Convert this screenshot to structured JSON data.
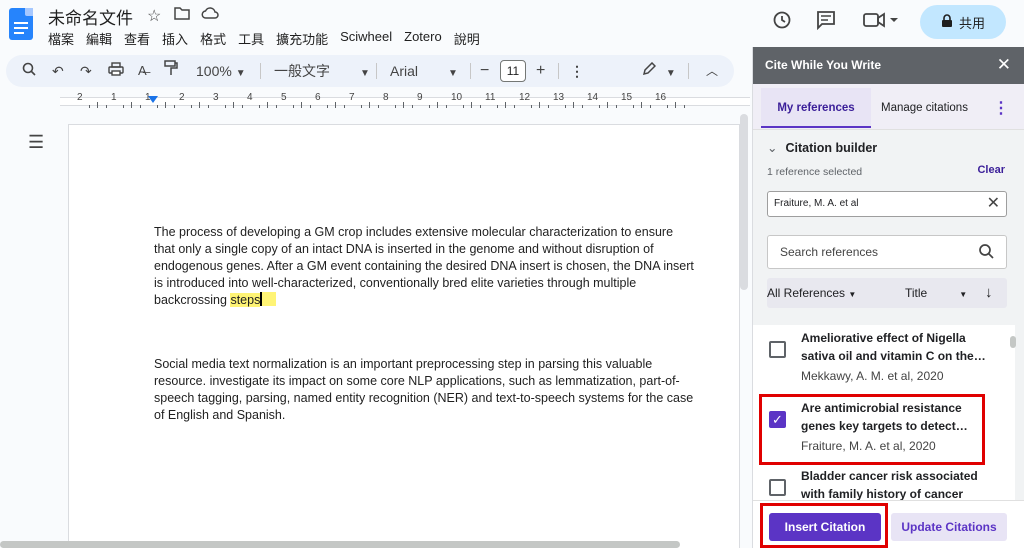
{
  "header": {
    "doc_title": "未命名文件",
    "menus": [
      "檔案",
      "編輯",
      "查看",
      "插入",
      "格式",
      "工具",
      "擴充功能",
      "Sciwheel",
      "Zotero",
      "說明"
    ],
    "share_label": "共用"
  },
  "toolbar": {
    "zoom": "100%",
    "style": "一般文字",
    "font": "Arial",
    "font_size": "11",
    "minus": "−",
    "plus": "+"
  },
  "ruler": {
    "numbers": [
      "2",
      "1",
      "1",
      "2",
      "3",
      "4",
      "5",
      "6",
      "7",
      "8",
      "9",
      "10",
      "11",
      "12",
      "13",
      "14",
      "15",
      "16"
    ]
  },
  "document": {
    "para1_main": "The process of developing a GM crop includes extensive molecular characterization to ensure that only a single copy of an intact DNA is inserted in the genome and without disruption of endogenous genes. After a GM event containing the desired DNA insert is chosen, the DNA insert is introduced into well-characterized, conventionally bred elite varieties through multiple backcrossing ",
    "para1_highlight": "steps",
    "para2": "Social media text normalization is an important preprocessing step in parsing this valuable resource. investigate its impact on some core NLP applications, such as lemmatization, part-of-speech tagging, parsing, named entity recognition (NER) and text-to-speech systems for the case of English and Spanish."
  },
  "panel": {
    "title": "Cite While You Write",
    "tab_my_references": "My references",
    "tab_manage_citations": "Manage citations",
    "citation_builder": "Citation builder",
    "reference_selected": "1 reference selected",
    "clear": "Clear",
    "selected_chip": "Fraiture, M. A. et al",
    "search_placeholder": "Search references",
    "filter_all": "All References",
    "sort_field": "Title",
    "items": [
      {
        "title": "Ameliorative effect of Nigella sativa oil and vitamin C on the…",
        "author": "Mekkawy, A. M. et al, 2020",
        "checked": false
      },
      {
        "title": "Are antimicrobial resistance genes key targets to detect…",
        "author": "Fraiture, M. A. et al, 2020",
        "checked": true
      },
      {
        "title": "Bladder cancer risk associated with family history of cancer",
        "author": "",
        "checked": false
      }
    ],
    "insert_citation": "Insert Citation",
    "update_citations": "Update Citations"
  },
  "colors": {
    "accent": "#5b34c5",
    "highlight": "#fff475",
    "annotation_red": "#e00000",
    "share_bg": "#c2e7ff"
  }
}
